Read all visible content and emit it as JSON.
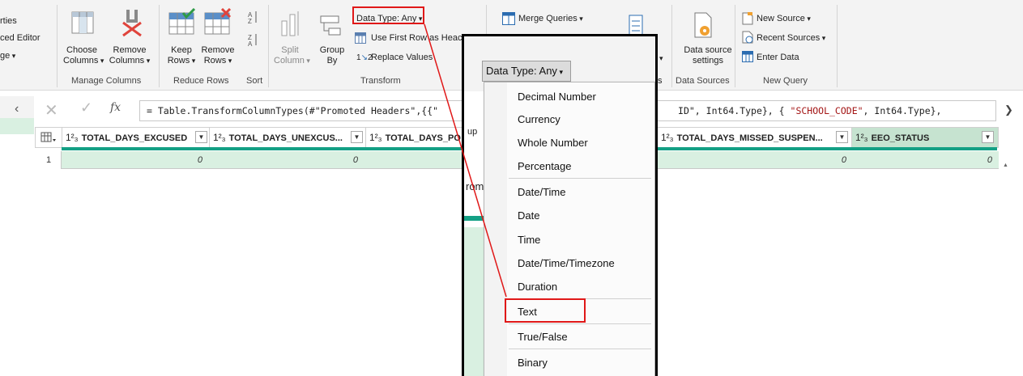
{
  "ribbon": {
    "left_items": [
      "rties",
      "ced Editor",
      "ge"
    ],
    "manage_columns": {
      "choose": [
        "Choose",
        "Columns"
      ],
      "remove": [
        "Remove",
        "Columns"
      ],
      "label": "Manage Columns"
    },
    "reduce_rows": {
      "keep": [
        "Keep",
        "Rows"
      ],
      "remove": [
        "Remove",
        "Rows"
      ],
      "label": "Reduce Rows"
    },
    "sort": {
      "label": "Sort"
    },
    "transform": {
      "split": [
        "Split",
        "Column"
      ],
      "group": [
        "Group",
        "By"
      ],
      "data_type": "Data Type: Any",
      "use_first_row": "Use First Row as Heac",
      "replace_values": "Replace Values",
      "label": "Transform"
    },
    "combine": {
      "merge": "Merge Queries",
      "label_tail": "s"
    },
    "data_sources": {
      "settings": [
        "Data source",
        "settings"
      ],
      "label": "Data Sources"
    },
    "new_query": {
      "new_source": "New Source",
      "recent_sources": "Recent Sources",
      "enter_data": "Enter Data",
      "label": "New Query"
    }
  },
  "formula": {
    "prefix": "= Table.TransformColumnTypes(#\"Promoted Headers\",{{\"",
    "mid": "ID\", Int64.Type}, {",
    "str": "\"SCHOOL_CODE\"",
    "suffix": ", Int64.Type},"
  },
  "columns": [
    {
      "type": "1²₃",
      "name": "TOTAL_DAYS_EXCUSED"
    },
    {
      "type": "1²₃",
      "name": "TOTAL_DAYS_UNEXCUS..."
    },
    {
      "type": "1²₃",
      "name": "TOTAL_DAYS_PO"
    },
    {
      "type": "1²₃",
      "name": "TOTAL_DAYS_MISSED_SUSPEN..."
    },
    {
      "type": "1²₃",
      "name": "EEO_STATUS"
    }
  ],
  "row": {
    "number": "1",
    "values": [
      "0",
      "0",
      "0"
    ]
  },
  "zoom": {
    "behind_text": [
      "ᴵᵖ",
      "up",
      "rom"
    ],
    "data_type_button": "Data Type: Any",
    "menu_items": [
      "Decimal Number",
      "Currency",
      "Whole Number",
      "Percentage",
      "Date/Time",
      "Date",
      "Time",
      "Date/Time/Timezone",
      "Duration",
      "Text",
      "True/False",
      "Binary"
    ],
    "highlighted": "Text"
  },
  "colors": {
    "annotation": "#e01818",
    "teal_accent": "#14a085",
    "selected_row": "#d9f0e1"
  }
}
